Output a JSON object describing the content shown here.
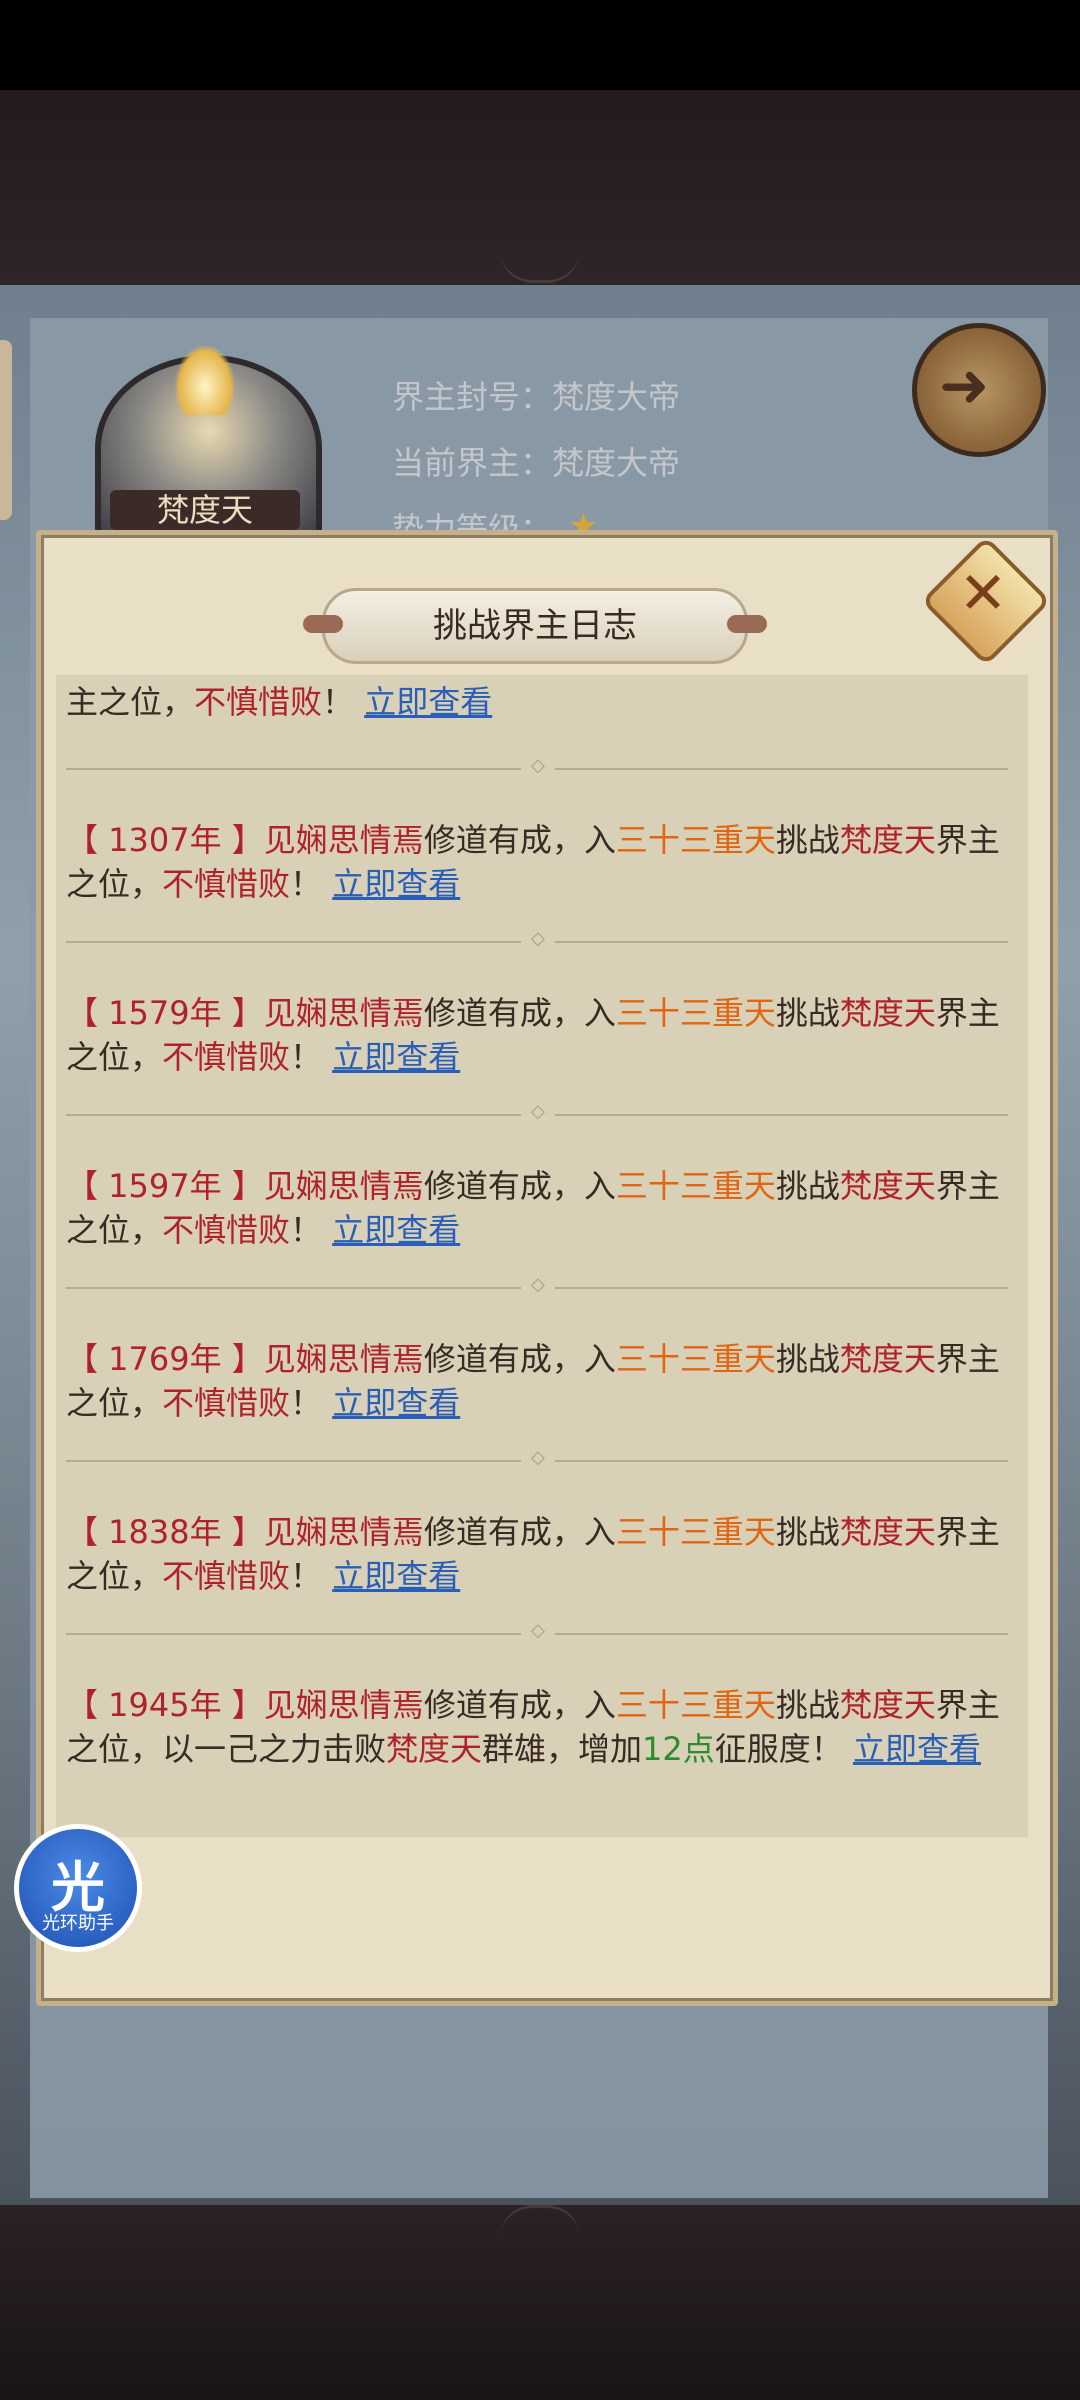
{
  "header": {
    "avatar_name": "梵度天",
    "info": [
      "界主封号：梵度大帝",
      "当前界主：梵度大帝",
      "势力等级："
    ],
    "star_icon": "star-icon",
    "back_icon": "back-arrow-icon"
  },
  "dialog": {
    "title": "挑战界主日志",
    "close_icon": "close-icon"
  },
  "entries": [
    {
      "parts": [
        {
          "t": "主之位，"
        },
        {
          "t": "不慎惜败",
          "c": "red"
        },
        {
          "t": "！ "
        },
        {
          "t": "立即查看",
          "c": "link"
        }
      ]
    },
    {
      "parts": [
        {
          "t": "【 1307年 】",
          "c": "red"
        },
        {
          "t": "见娴思情焉",
          "c": "red"
        },
        {
          "t": "修道有成，入"
        },
        {
          "t": "三十三重天",
          "c": "orange"
        },
        {
          "t": "挑战"
        },
        {
          "t": "梵度天",
          "c": "red"
        },
        {
          "t": "界主之位，"
        },
        {
          "t": "不慎惜败",
          "c": "red"
        },
        {
          "t": "！ "
        },
        {
          "t": "立即查看",
          "c": "link"
        }
      ]
    },
    {
      "parts": [
        {
          "t": "【 1579年 】",
          "c": "red"
        },
        {
          "t": "见娴思情焉",
          "c": "red"
        },
        {
          "t": "修道有成，入"
        },
        {
          "t": "三十三重天",
          "c": "orange"
        },
        {
          "t": "挑战"
        },
        {
          "t": "梵度天",
          "c": "red"
        },
        {
          "t": "界主之位，"
        },
        {
          "t": "不慎惜败",
          "c": "red"
        },
        {
          "t": "！ "
        },
        {
          "t": "立即查看",
          "c": "link"
        }
      ]
    },
    {
      "parts": [
        {
          "t": "【 1597年 】",
          "c": "red"
        },
        {
          "t": "见娴思情焉",
          "c": "red"
        },
        {
          "t": "修道有成，入"
        },
        {
          "t": "三十三重天",
          "c": "orange"
        },
        {
          "t": "挑战"
        },
        {
          "t": "梵度天",
          "c": "red"
        },
        {
          "t": "界主之位，"
        },
        {
          "t": "不慎惜败",
          "c": "red"
        },
        {
          "t": "！ "
        },
        {
          "t": "立即查看",
          "c": "link"
        }
      ]
    },
    {
      "parts": [
        {
          "t": "【 1769年 】",
          "c": "red"
        },
        {
          "t": "见娴思情焉",
          "c": "red"
        },
        {
          "t": "修道有成，入"
        },
        {
          "t": "三十三重天",
          "c": "orange"
        },
        {
          "t": "挑战"
        },
        {
          "t": "梵度天",
          "c": "red"
        },
        {
          "t": "界主之位，"
        },
        {
          "t": "不慎惜败",
          "c": "red"
        },
        {
          "t": "！ "
        },
        {
          "t": "立即查看",
          "c": "link"
        }
      ]
    },
    {
      "parts": [
        {
          "t": "【 1838年 】",
          "c": "red"
        },
        {
          "t": "见娴思情焉",
          "c": "red"
        },
        {
          "t": "修道有成，入"
        },
        {
          "t": "三十三重天",
          "c": "orange"
        },
        {
          "t": "挑战"
        },
        {
          "t": "梵度天",
          "c": "red"
        },
        {
          "t": "界主之位，"
        },
        {
          "t": "不慎惜败",
          "c": "red"
        },
        {
          "t": "！ "
        },
        {
          "t": "立即查看",
          "c": "link"
        }
      ]
    },
    {
      "parts": [
        {
          "t": "【 1945年 】",
          "c": "red"
        },
        {
          "t": "见娴思情焉",
          "c": "red"
        },
        {
          "t": "修道有成，入"
        },
        {
          "t": "三十三重天",
          "c": "orange"
        },
        {
          "t": "挑战"
        },
        {
          "t": "梵度天",
          "c": "red"
        },
        {
          "t": "界主之位，以一己之力击败"
        },
        {
          "t": "梵度天",
          "c": "red"
        },
        {
          "t": "群雄，增加"
        },
        {
          "t": "12点",
          "c": "green"
        },
        {
          "t": "征服度！ "
        },
        {
          "t": "立即查看",
          "c": "link"
        }
      ]
    }
  ],
  "helper": {
    "glyph": "光",
    "label": "光环助手"
  }
}
